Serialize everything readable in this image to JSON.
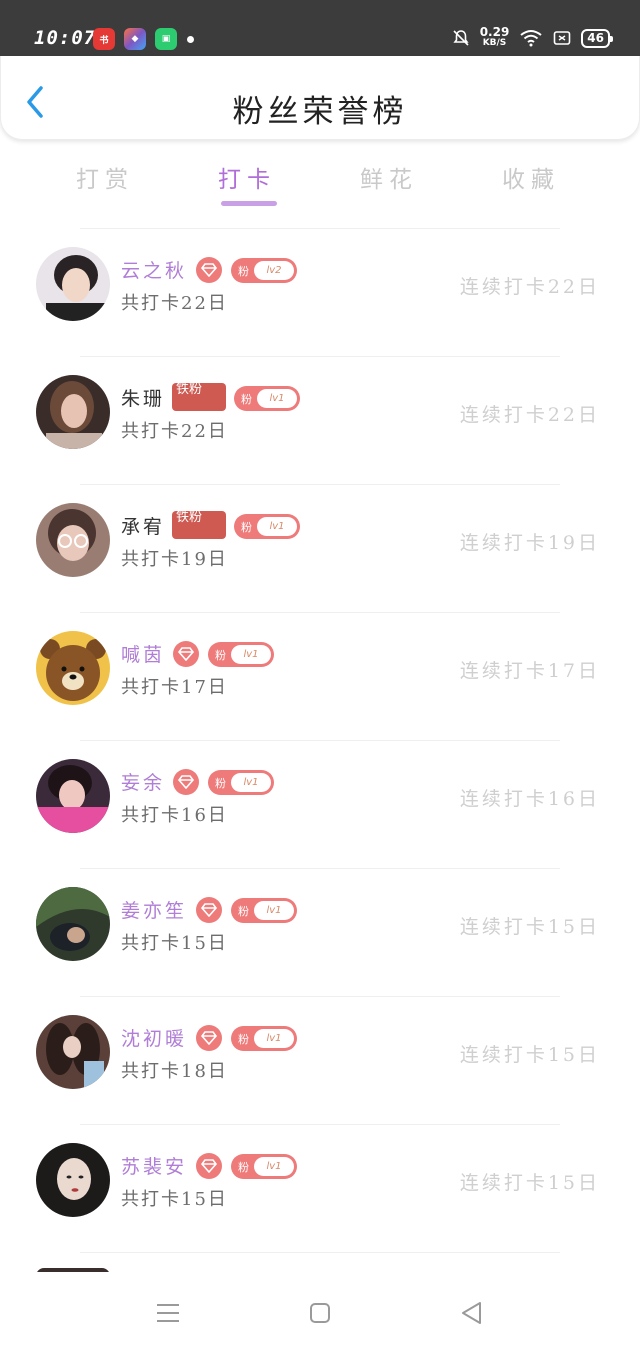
{
  "status_bar": {
    "time": "10:07",
    "net_speed": "0.29",
    "net_unit": "KB/S",
    "battery": "46",
    "app_icons": [
      "xiaohongshu-app-icon",
      "multicolor-app-icon",
      "green-app-icon"
    ]
  },
  "header": {
    "title": "粉丝荣誉榜",
    "back_icon": "chevron-left-icon"
  },
  "tabs": [
    {
      "label": "打赏",
      "active": false
    },
    {
      "label": "打卡",
      "active": true
    },
    {
      "label": "鲜花",
      "active": false
    },
    {
      "label": "收藏",
      "active": false
    }
  ],
  "colors": {
    "accent": "#b06fd8",
    "badge": "#ee7a7a",
    "title_badge": "#cf5a52",
    "back_arrow": "#2a9ae6"
  },
  "entries": [
    {
      "name": "云之秋",
      "total": "共打卡22日",
      "streak": "连续打卡22日",
      "badge_type": "diamond",
      "fan_label": "粉",
      "level": "lv2",
      "name_style": "purple"
    },
    {
      "name": "朱珊",
      "total": "共打卡22日",
      "streak": "连续打卡22日",
      "badge_type": "title",
      "title_text": "铁粉",
      "fan_label": "粉",
      "level": "lv1",
      "name_style": "dark"
    },
    {
      "name": "承宥",
      "total": "共打卡19日",
      "streak": "连续打卡19日",
      "badge_type": "title",
      "title_text": "铁粉",
      "fan_label": "粉",
      "level": "lv1",
      "name_style": "dark"
    },
    {
      "name": "喊茵",
      "total": "共打卡17日",
      "streak": "连续打卡17日",
      "badge_type": "diamond",
      "fan_label": "粉",
      "level": "lv1",
      "name_style": "purple"
    },
    {
      "name": "妄余",
      "total": "共打卡16日",
      "streak": "连续打卡16日",
      "badge_type": "diamond",
      "fan_label": "粉",
      "level": "lv1",
      "name_style": "purple"
    },
    {
      "name": "姜亦笙",
      "total": "共打卡15日",
      "streak": "连续打卡15日",
      "badge_type": "diamond",
      "fan_label": "粉",
      "level": "lv1",
      "name_style": "purple"
    },
    {
      "name": "沈初暖",
      "total": "共打卡18日",
      "streak": "连续打卡15日",
      "badge_type": "diamond",
      "fan_label": "粉",
      "level": "lv1",
      "name_style": "purple"
    },
    {
      "name": "苏裴安",
      "total": "共打卡15日",
      "streak": "连续打卡15日",
      "badge_type": "diamond",
      "fan_label": "粉",
      "level": "lv1",
      "name_style": "purple"
    }
  ],
  "nav_bar": [
    "menu-icon",
    "home-square-icon",
    "back-triangle-icon"
  ]
}
